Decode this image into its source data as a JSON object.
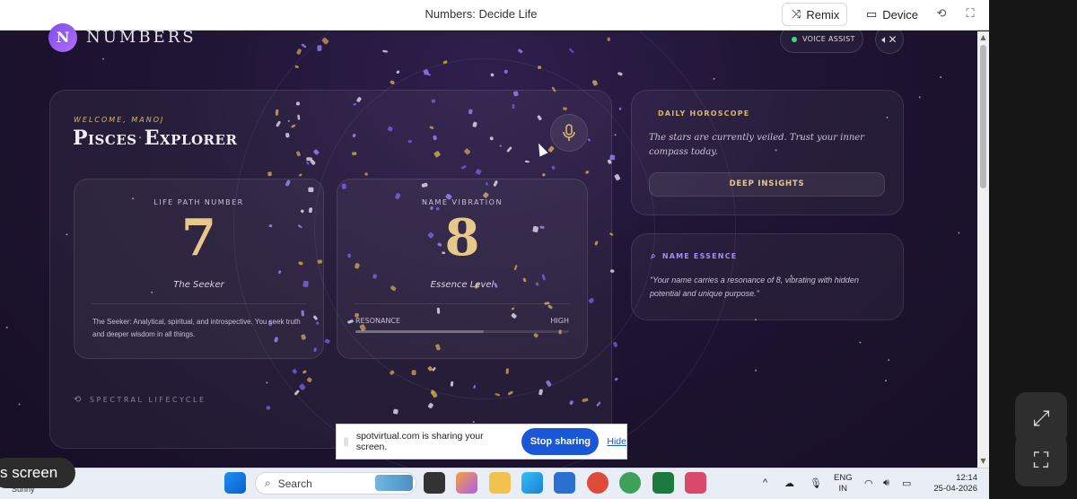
{
  "window": {
    "title": "Numbers: Decide Life",
    "remix_label": "Remix",
    "device_label": "Device"
  },
  "app": {
    "logo_letter": "N",
    "logo_text": "NUMBERS",
    "voice_assist_label": "VOICE ASSIST",
    "welcome": "WELCOME, MANOJ",
    "profile_title": "Pisces Explorer",
    "life_path": {
      "label": "LIFE PATH NUMBER",
      "number": "7",
      "caption": "The Seeker",
      "description": "The Seeker: Analytical, spiritual, and introspective. You seek truth and deeper wisdom in all things."
    },
    "name_vibration": {
      "label": "NAME VIBRATION",
      "number": "8",
      "caption": "Essence Level",
      "resonance_label": "RESONANCE",
      "resonance_level_label": "HIGH",
      "resonance_fraction": 0.6
    },
    "spectral_label": "SPECTRAL LIFECYCLE",
    "horoscope": {
      "title": "DAILY HOROSCOPE",
      "text": "The stars are currently veiled. Trust your inner compass today.",
      "button_label": "DEEP INSIGHTS"
    },
    "name_essence": {
      "title": "NAME ESSENCE",
      "text": "\"Your name carries a resonance of 8, vibrating with hidden potential and unique purpose.\""
    }
  },
  "share_bar": {
    "text": "spotvirtual.com is sharing your screen.",
    "stop_label": "Stop sharing",
    "hide_label": "Hide"
  },
  "overlay": {
    "screen_pill_text": "s screen"
  },
  "taskbar": {
    "weather_sub": "Sunny",
    "search_placeholder": "Search",
    "lang_line1": "ENG",
    "lang_line2": "IN",
    "time": "12:14",
    "date": "25-04-2026"
  },
  "icons": [
    "remix-icon",
    "device-icon",
    "refresh-icon",
    "fullscreen-icon",
    "mute-icon",
    "mic-icon",
    "search-icon",
    "history-icon",
    "expand-icon",
    "fit-screen-icon"
  ]
}
